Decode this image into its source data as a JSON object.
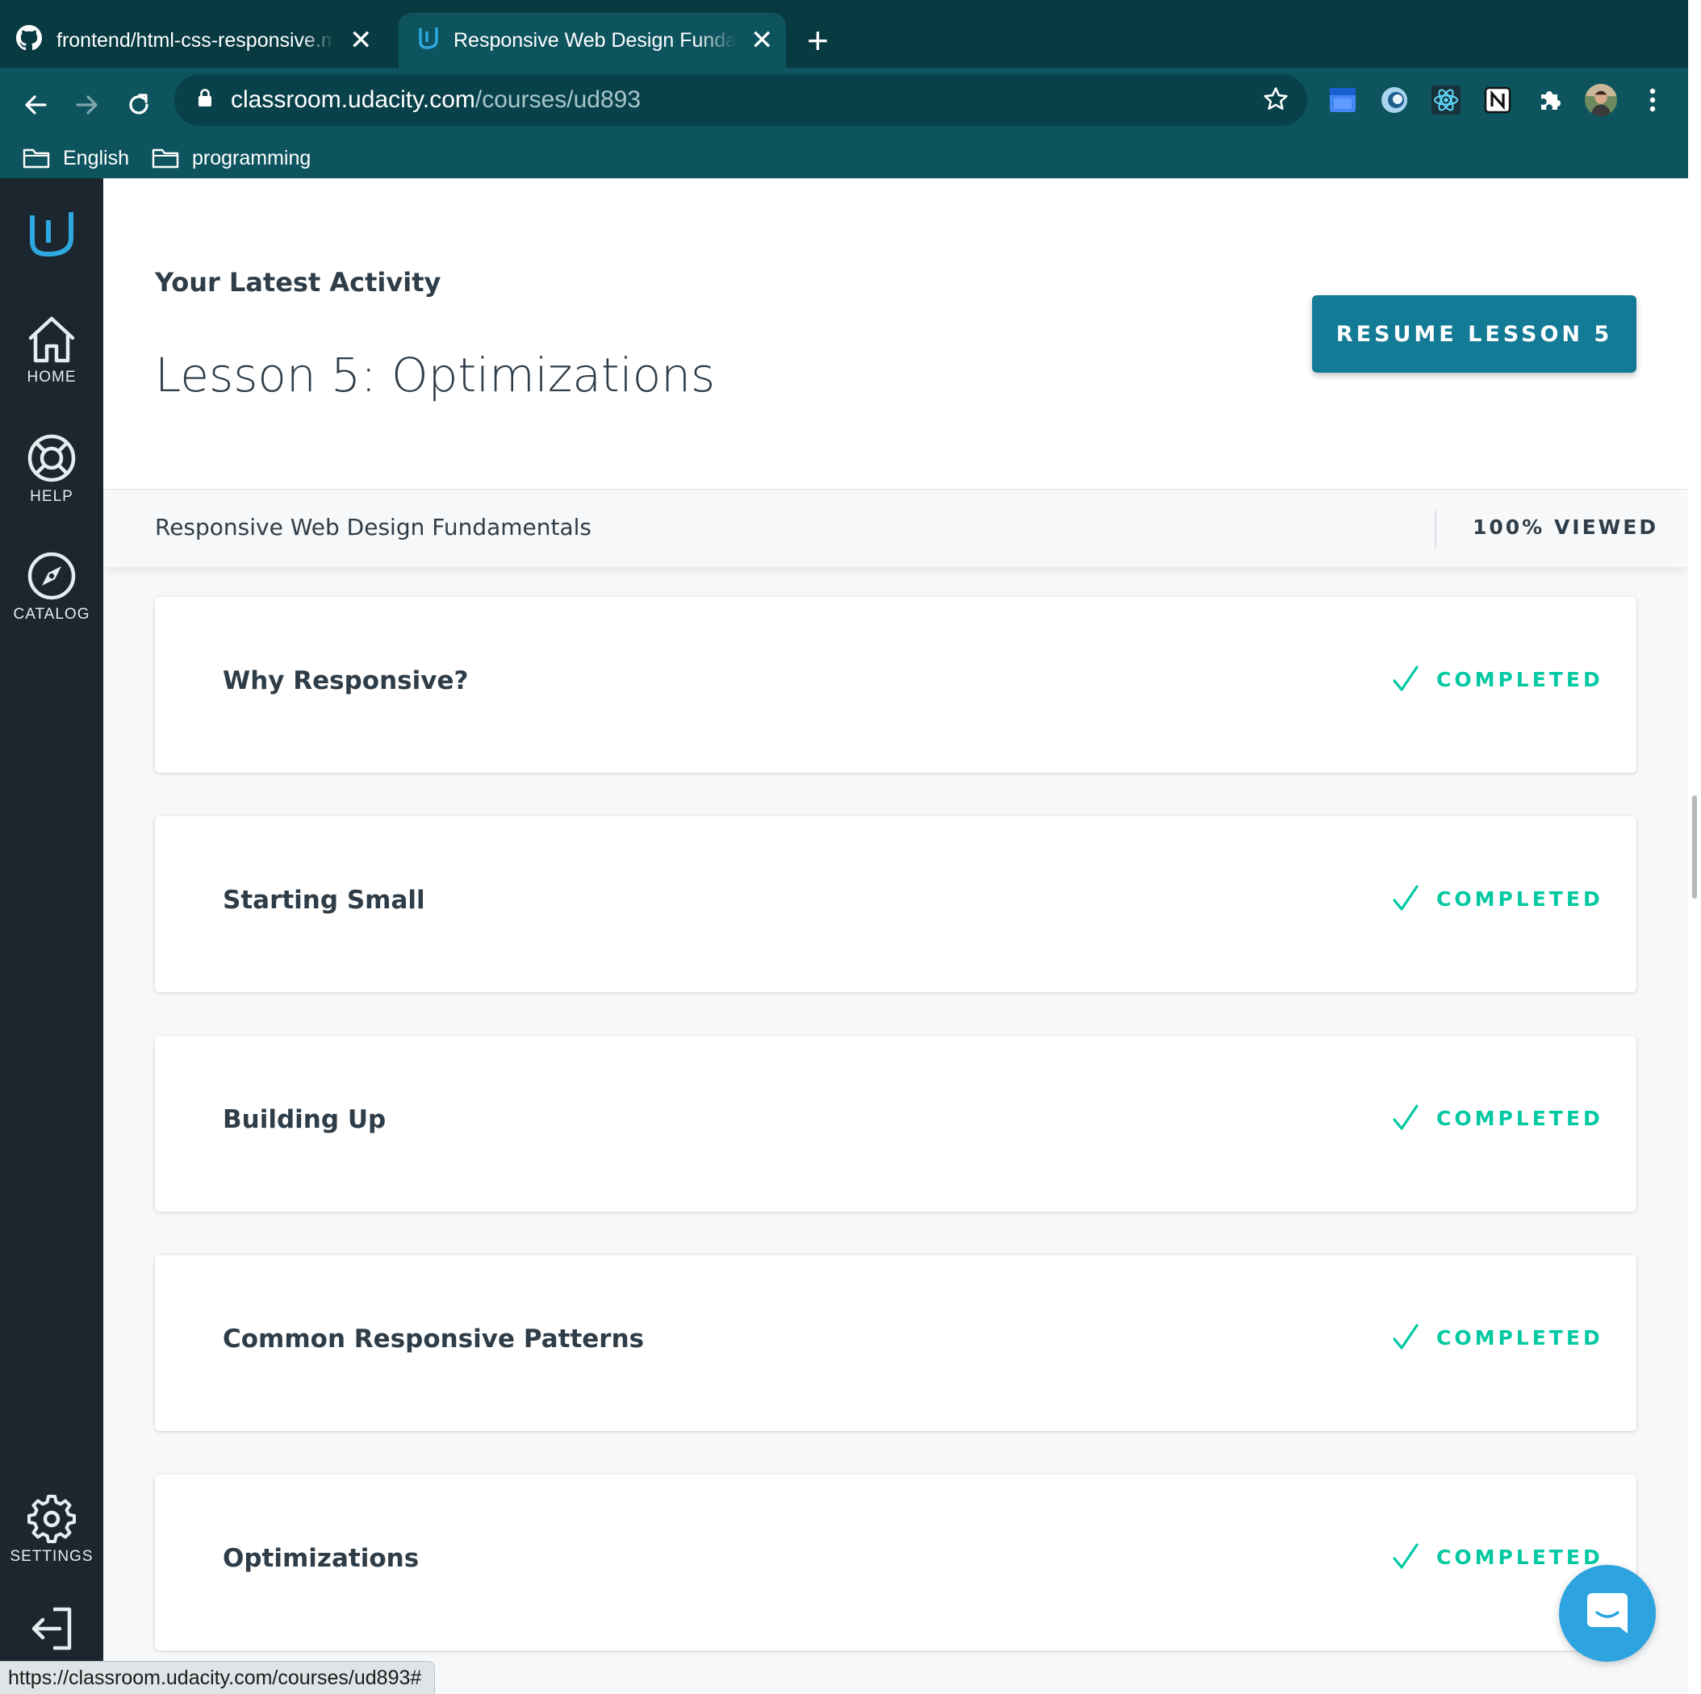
{
  "browser": {
    "tabs": [
      {
        "title": "frontend/html-css-responsive.md",
        "icon": "github-icon",
        "active": false
      },
      {
        "title": "Responsive Web Design Fundamentals",
        "icon": "udacity-icon",
        "active": true
      }
    ],
    "close_glyph": "✕",
    "new_tab_glyph": "+",
    "url_host": "classroom.udacity.com",
    "url_path": "/courses/ud893",
    "bookmarks": [
      {
        "label": "English",
        "icon": "folder-icon"
      },
      {
        "label": "programming",
        "icon": "folder-icon"
      }
    ],
    "extensions": [
      "google-calendar-icon",
      "circle-extension-icon",
      "react-devtools-icon",
      "notion-icon",
      "puzzle-icon",
      "profile-avatar"
    ],
    "status_url": "https://classroom.udacity.com/courses/ud893#",
    "colors": {
      "tabbar": "#073a41",
      "toolbar": "#0e545e"
    }
  },
  "sidebar": {
    "items": [
      {
        "label": "HOME",
        "icon": "home-icon"
      },
      {
        "label": "HELP",
        "icon": "lifebuoy-icon"
      },
      {
        "label": "CATALOG",
        "icon": "compass-icon"
      },
      {
        "label": "SETTINGS",
        "icon": "gear-icon"
      },
      {
        "label": "",
        "icon": "logout-icon"
      }
    ]
  },
  "activity": {
    "label": "Your Latest Activity",
    "lesson_title": "Lesson 5: Optimizations",
    "resume_button": "RESUME LESSON 5"
  },
  "course": {
    "name": "Responsive Web Design Fundamentals",
    "progress_text": "100% VIEWED",
    "progress": 1.0
  },
  "lessons": [
    {
      "title": "Why Responsive?",
      "status": "COMPLETED"
    },
    {
      "title": "Starting Small",
      "status": "COMPLETED"
    },
    {
      "title": "Building Up",
      "status": "COMPLETED"
    },
    {
      "title": "Common Responsive Patterns",
      "status": "COMPLETED"
    },
    {
      "title": "Optimizations",
      "status": "COMPLETED"
    }
  ],
  "colors": {
    "accent": "#137b96",
    "completed": "#02c9a2",
    "sidebar": "#1c262f",
    "chat": "#2da3e0"
  }
}
